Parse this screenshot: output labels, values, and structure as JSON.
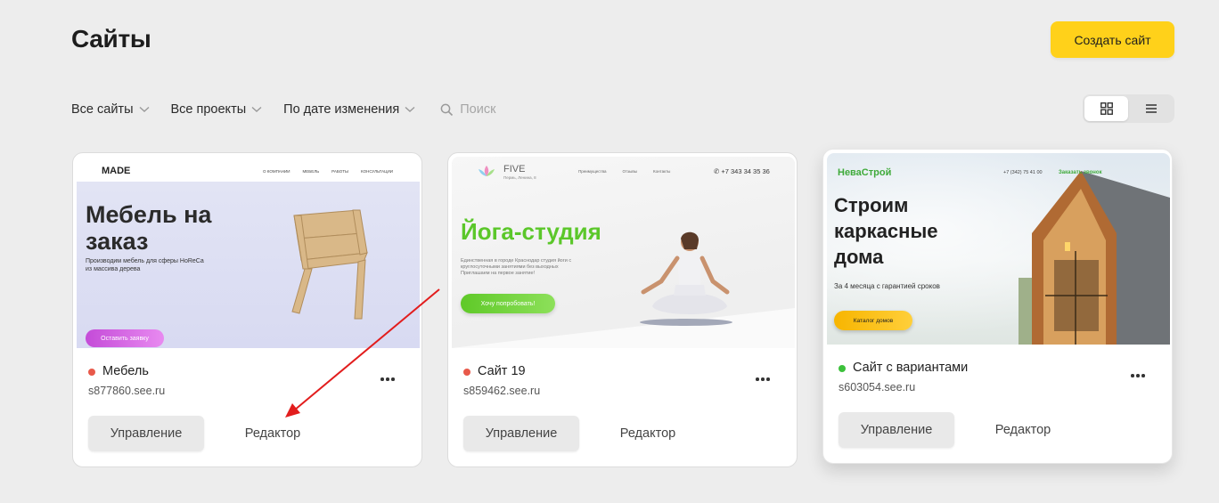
{
  "header": {
    "title": "Сайты",
    "create_label": "Создать сайт"
  },
  "filters": {
    "all_sites": "Все сайты",
    "all_projects": "Все проекты",
    "sort": "По дате изменения",
    "search_placeholder": "Поиск"
  },
  "view": {
    "active": "grid"
  },
  "colors": {
    "accent": "#ffd11a",
    "status_red": "#e8594a",
    "status_green": "#3cc13b"
  },
  "cards": [
    {
      "name": "Мебель",
      "domain": "s877860.see.ru",
      "status": "red",
      "manage_label": "Управление",
      "editor_label": "Редактор",
      "preview": {
        "logo": "MADE",
        "nav": [
          "О КОМПАНИИ",
          "МЕБЕЛЬ",
          "РАБОТЫ",
          "КОНСУЛЬТАЦИИ"
        ],
        "headline_1": "Мебель на",
        "headline_2": "заказ",
        "sub_1": "Производим мебель для сферы HoReCa",
        "sub_2": "из массива дерева",
        "cta": "Оставить заявку"
      }
    },
    {
      "name": "Сайт 19",
      "domain": "s859462.see.ru",
      "status": "red",
      "manage_label": "Управление",
      "editor_label": "Редактор",
      "preview": {
        "logo": "FIVE",
        "logo_sub": "Пермь, Ленина, 8",
        "nav": [
          "Преимущества",
          "Отзывы",
          "Контакты"
        ],
        "phone": "+7 343 34 35 36",
        "headline": "Йога-студия",
        "sub_1": "Единственная в городе Краснодар студия йоги с",
        "sub_2": "круглосуточными занятиями без выходных",
        "sub_3": "Приглашаем на первое занятие!",
        "cta": "Хочу попробовать!"
      }
    },
    {
      "name": "Сайт с вариантами",
      "domain": "s603054.see.ru",
      "status": "green",
      "manage_label": "Управление",
      "editor_label": "Редактор",
      "preview": {
        "logo": "НеваСтрой",
        "phone": "+7 (342) 75 41 00",
        "call": "Заказать звонок",
        "headline_1": "Строим",
        "headline_2": "каркасные",
        "headline_3": "дома",
        "sub": "За 4 месяца с гарантией сроков",
        "cta": "Каталог домов"
      }
    }
  ]
}
